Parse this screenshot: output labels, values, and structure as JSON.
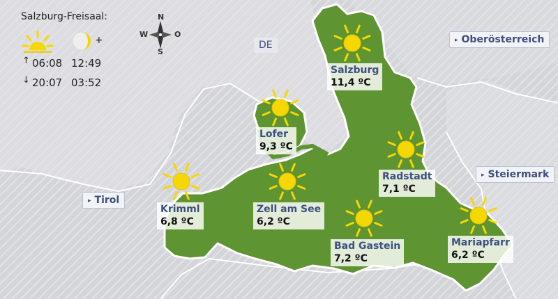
{
  "info": {
    "location": "Salzburg-Freisaal:",
    "sunrise": "06:08",
    "sunset": "20:07",
    "moonrise": "12:49",
    "moonset": "03:52",
    "moon_suffix": "+",
    "sunrise_arrow": "↑",
    "sunset_arrow": "↓"
  },
  "compass": {
    "n": "N",
    "s": "S",
    "w": "W",
    "e": "O"
  },
  "country_label": "DE",
  "neighbors": [
    {
      "label": "Oberösterreich"
    },
    {
      "label": "Steiermark"
    },
    {
      "label": "Tirol"
    }
  ],
  "neighbor_marker": "▸",
  "stations": [
    {
      "name": "Salzburg",
      "temp": "11,4 ºC",
      "icon": "sun-icon"
    },
    {
      "name": "Lofer",
      "temp": "9,3 ºC",
      "icon": "sun-icon"
    },
    {
      "name": "Radstadt",
      "temp": "7,1 ºC",
      "icon": "sun-icon"
    },
    {
      "name": "Krimml",
      "temp": "6,8 ºC",
      "icon": "sun-icon"
    },
    {
      "name": "Zell am See",
      "temp": "6,2 ºC",
      "icon": "sun-icon"
    },
    {
      "name": "Bad Gastein",
      "temp": "7,2 ºC",
      "icon": "sun-icon"
    },
    {
      "name": "Mariapfarr",
      "temp": "6,2 ºC",
      "icon": "sun-icon"
    }
  ],
  "colors": {
    "state_fill": "#5e9431",
    "state_border": "#ffffff",
    "background": "#d4d5d9",
    "sun": "#f6d800",
    "link_text": "#3d4f7e"
  }
}
